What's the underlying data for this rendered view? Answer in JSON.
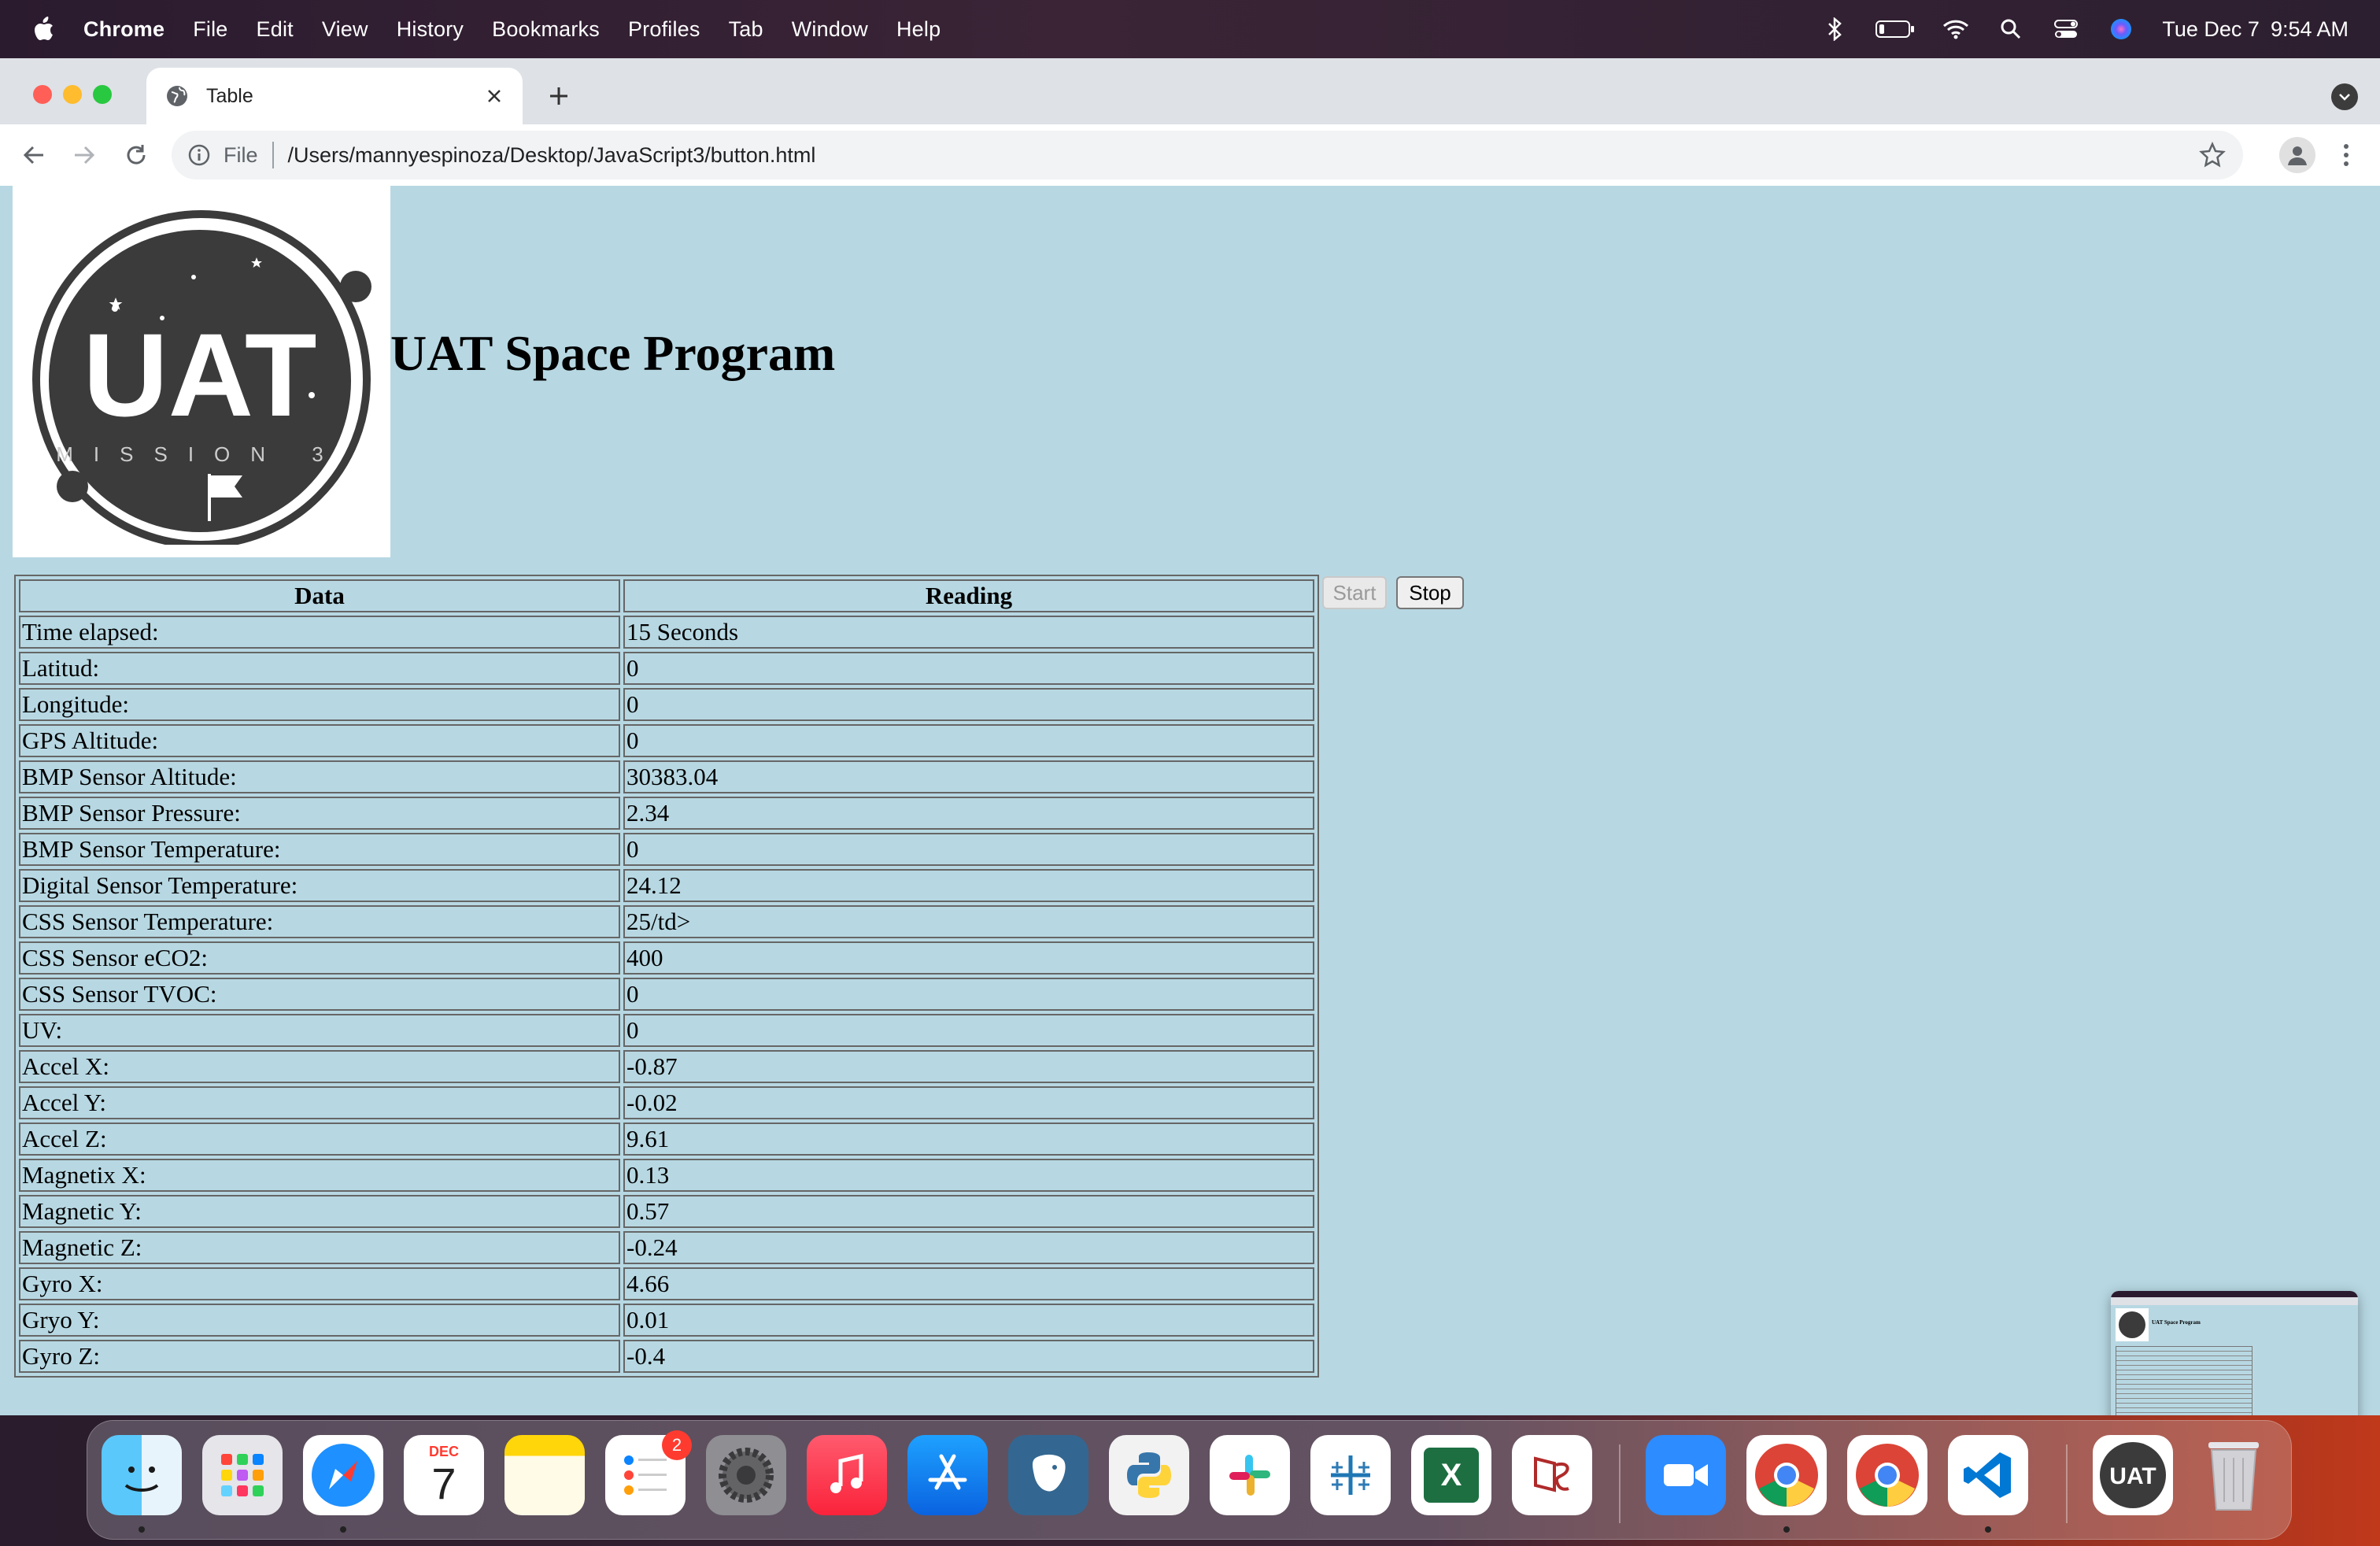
{
  "menubar": {
    "app": "Chrome",
    "items": [
      "File",
      "Edit",
      "View",
      "History",
      "Bookmarks",
      "Profiles",
      "Tab",
      "Window",
      "Help"
    ],
    "date": "Tue Dec 7",
    "time": "9:54 AM"
  },
  "browser": {
    "tab_title": "Table",
    "scheme_label": "File",
    "url": "/Users/mannyespinoza/Desktop/JavaScript3/button.html"
  },
  "page": {
    "title": "UAT Space Program",
    "logo": {
      "text_main": "UAT",
      "text_sub": "MISSION 3"
    },
    "table": {
      "headers": [
        "Data",
        "Reading"
      ],
      "rows": [
        [
          "Time elapsed:",
          "15 Seconds"
        ],
        [
          "Latitud:",
          "0"
        ],
        [
          "Longitude:",
          "0"
        ],
        [
          "GPS Altitude:",
          "0"
        ],
        [
          "BMP Sensor Altitude:",
          "30383.04"
        ],
        [
          "BMP Sensor Pressure:",
          "2.34"
        ],
        [
          "BMP Sensor Temperature:",
          "0"
        ],
        [
          "Digital Sensor Temperature:",
          "24.12"
        ],
        [
          "CSS Sensor Temperature:",
          "25/td>"
        ],
        [
          "CSS Sensor eCO2:",
          "400"
        ],
        [
          "CSS Sensor TVOC:",
          "0"
        ],
        [
          "UV:",
          "0"
        ],
        [
          "Accel X:",
          "-0.87"
        ],
        [
          "Accel Y:",
          "-0.02"
        ],
        [
          "Accel Z:",
          "9.61"
        ],
        [
          "Magnetix X:",
          "0.13"
        ],
        [
          "Magnetic Y:",
          "0.57"
        ],
        [
          "Magnetic Z:",
          "-0.24"
        ],
        [
          "Gyro X:",
          "4.66"
        ],
        [
          "Gryo Y:",
          "0.01"
        ],
        [
          "Gyro Z:",
          "-0.4"
        ]
      ]
    },
    "buttons": {
      "start": "Start",
      "stop": "Stop"
    }
  },
  "thumbnail": {
    "title": "UAT Space Program"
  },
  "dock": {
    "calendar_month": "DEC",
    "calendar_day": "7",
    "reminders_badge": "2",
    "excel_letter": "X",
    "uat_label": "UAT",
    "apps": [
      "finder-icon",
      "launchpad-icon",
      "safari-icon",
      "calendar-icon",
      "notes-icon",
      "reminders-icon",
      "system-preferences-icon",
      "music-icon",
      "app-store-icon",
      "postgresql-icon",
      "python-icon",
      "slack-icon",
      "tableau-icon",
      "excel-icon",
      "sublime-icon",
      "zoom-icon",
      "chrome-icon",
      "chrome-icon",
      "vscode-icon",
      "uat-app-icon",
      "trash-icon"
    ]
  },
  "colors": {
    "page_bg": "#b7d8e3",
    "menubar_bg": "#2b1b2f",
    "tabstrip_bg": "#dee1e6"
  }
}
